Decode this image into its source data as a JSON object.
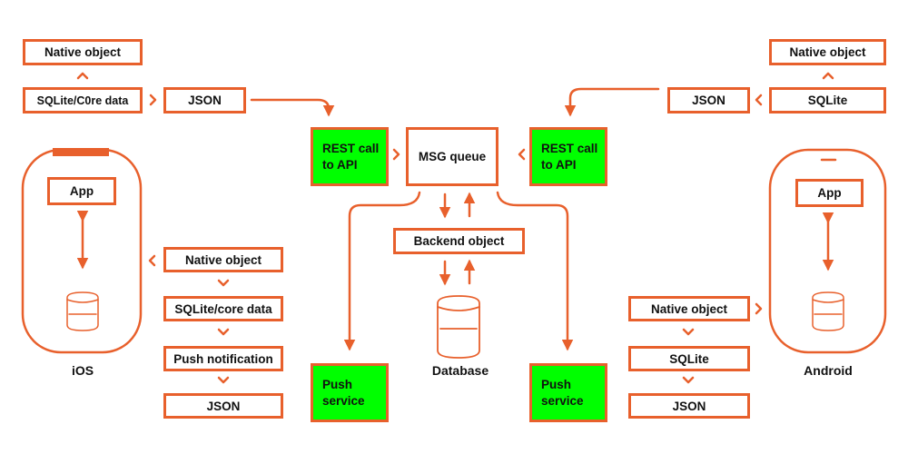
{
  "colors": {
    "accent": "#e8602c",
    "highlight": "#00ff00"
  },
  "ios": {
    "label": "iOS",
    "app": "App",
    "top_native": "Native object",
    "top_sqlite": "SQLite/C0re data",
    "top_json": "JSON",
    "stack": [
      "Native object",
      "SQLite/core data",
      "Push notification",
      "JSON"
    ]
  },
  "android": {
    "label": "Android",
    "app": "App",
    "top_native": "Native object",
    "top_sqlite": "SQLite",
    "top_json": "JSON",
    "stack": [
      "Native object",
      "SQLite",
      "JSON"
    ]
  },
  "center": {
    "rest_left": "REST call to API",
    "rest_right": "REST call to API",
    "msg_queue": "MSG queue",
    "backend": "Backend object",
    "database": "Database",
    "push_left": "Push service",
    "push_right": "Push service"
  }
}
